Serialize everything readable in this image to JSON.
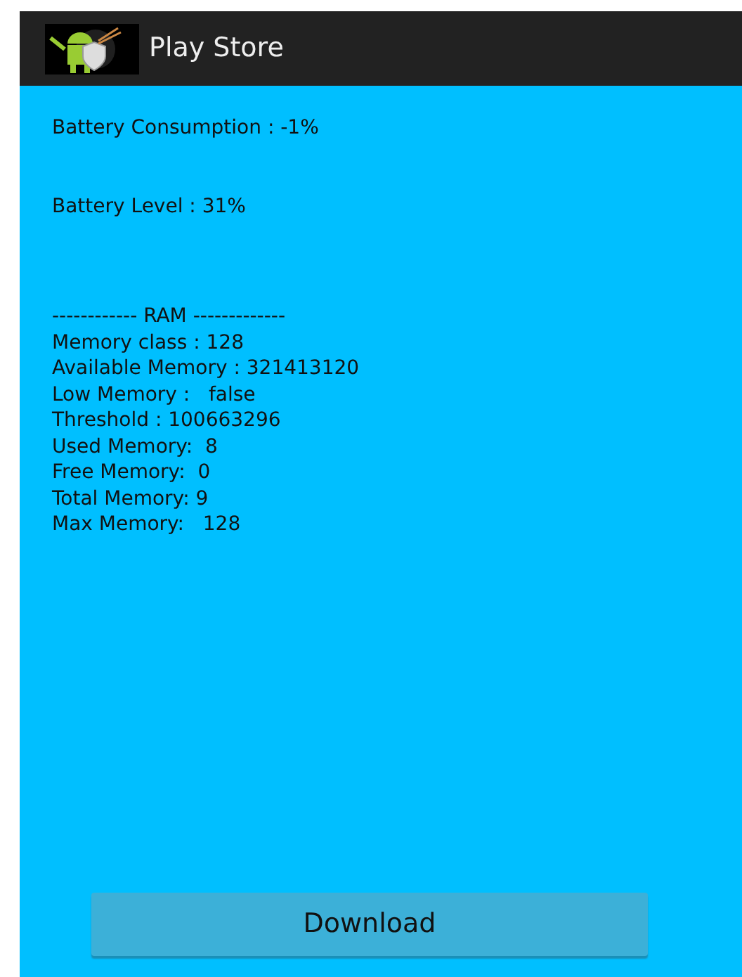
{
  "action_bar": {
    "title": "Play Store"
  },
  "battery": [
    "Battery Consumption : -1%",
    "Battery Level : 31%"
  ],
  "ram_lines": [
    "------------ RAM -------------",
    "Memory class : 128",
    "Available Memory : 321413120",
    "Low Memory :   false",
    "Threshold : 100663296",
    "Used Memory:  8",
    "Free Memory:  0",
    "Total Memory: 9",
    "Max Memory:   128"
  ],
  "button": "Download"
}
